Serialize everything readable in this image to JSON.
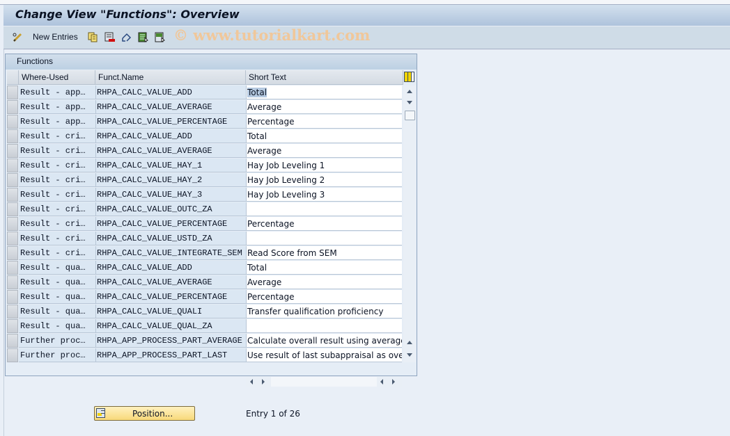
{
  "window": {
    "title": "Change View \"Functions\": Overview"
  },
  "toolbar": {
    "new_entries_label": "New Entries",
    "icons": [
      "change-display-icon",
      "copy-icon",
      "delete-icon",
      "undo-change-icon",
      "select-all-icon",
      "deselect-all-icon"
    ],
    "watermark": "© www.tutorialkart.com"
  },
  "table": {
    "title": "Functions",
    "columns": [
      "Where-Used",
      "Funct.Name",
      "Short Text"
    ],
    "rows": [
      {
        "where_used": "Result - app…",
        "funct_name": "RHPA_CALC_VALUE_ADD",
        "short_text": "Total",
        "selected": true
      },
      {
        "where_used": "Result - app…",
        "funct_name": "RHPA_CALC_VALUE_AVERAGE",
        "short_text": "Average"
      },
      {
        "where_used": "Result - app…",
        "funct_name": "RHPA_CALC_VALUE_PERCENTAGE",
        "short_text": "Percentage"
      },
      {
        "where_used": "Result - cri…",
        "funct_name": "RHPA_CALC_VALUE_ADD",
        "short_text": "Total"
      },
      {
        "where_used": "Result - cri…",
        "funct_name": "RHPA_CALC_VALUE_AVERAGE",
        "short_text": "Average"
      },
      {
        "where_used": "Result - cri…",
        "funct_name": "RHPA_CALC_VALUE_HAY_1",
        "short_text": "Hay Job Leveling 1"
      },
      {
        "where_used": "Result - cri…",
        "funct_name": "RHPA_CALC_VALUE_HAY_2",
        "short_text": "Hay Job Leveling 2"
      },
      {
        "where_used": "Result - cri…",
        "funct_name": "RHPA_CALC_VALUE_HAY_3",
        "short_text": "Hay Job Leveling 3"
      },
      {
        "where_used": "Result - cri…",
        "funct_name": "RHPA_CALC_VALUE_OUTC_ZA",
        "short_text": ""
      },
      {
        "where_used": "Result - cri…",
        "funct_name": "RHPA_CALC_VALUE_PERCENTAGE",
        "short_text": "Percentage"
      },
      {
        "where_used": "Result - cri…",
        "funct_name": "RHPA_CALC_VALUE_USTD_ZA",
        "short_text": ""
      },
      {
        "where_used": "Result - cri…",
        "funct_name": "RHPA_CALC_VALUE_INTEGRATE_SEM",
        "short_text": "Read Score from SEM"
      },
      {
        "where_used": "Result - qua…",
        "funct_name": "RHPA_CALC_VALUE_ADD",
        "short_text": "Total"
      },
      {
        "where_used": "Result - qua…",
        "funct_name": "RHPA_CALC_VALUE_AVERAGE",
        "short_text": "Average"
      },
      {
        "where_used": "Result - qua…",
        "funct_name": "RHPA_CALC_VALUE_PERCENTAGE",
        "short_text": "Percentage"
      },
      {
        "where_used": "Result - qua…",
        "funct_name": "RHPA_CALC_VALUE_QUALI",
        "short_text": "Transfer qualification proficiency"
      },
      {
        "where_used": "Result - qua…",
        "funct_name": "RHPA_CALC_VALUE_QUAL_ZA",
        "short_text": ""
      },
      {
        "where_used": "Further proc…",
        "funct_name": "RHPA_APP_PROCESS_PART_AVERAGE",
        "short_text": "Calculate overall result using averages"
      },
      {
        "where_used": "Further proc…",
        "funct_name": "RHPA_APP_PROCESS_PART_LAST",
        "short_text": "Use result of last subappraisal as overall re"
      }
    ]
  },
  "footer": {
    "position_button_label": "Position...",
    "entry_text": "Entry 1 of 26"
  }
}
